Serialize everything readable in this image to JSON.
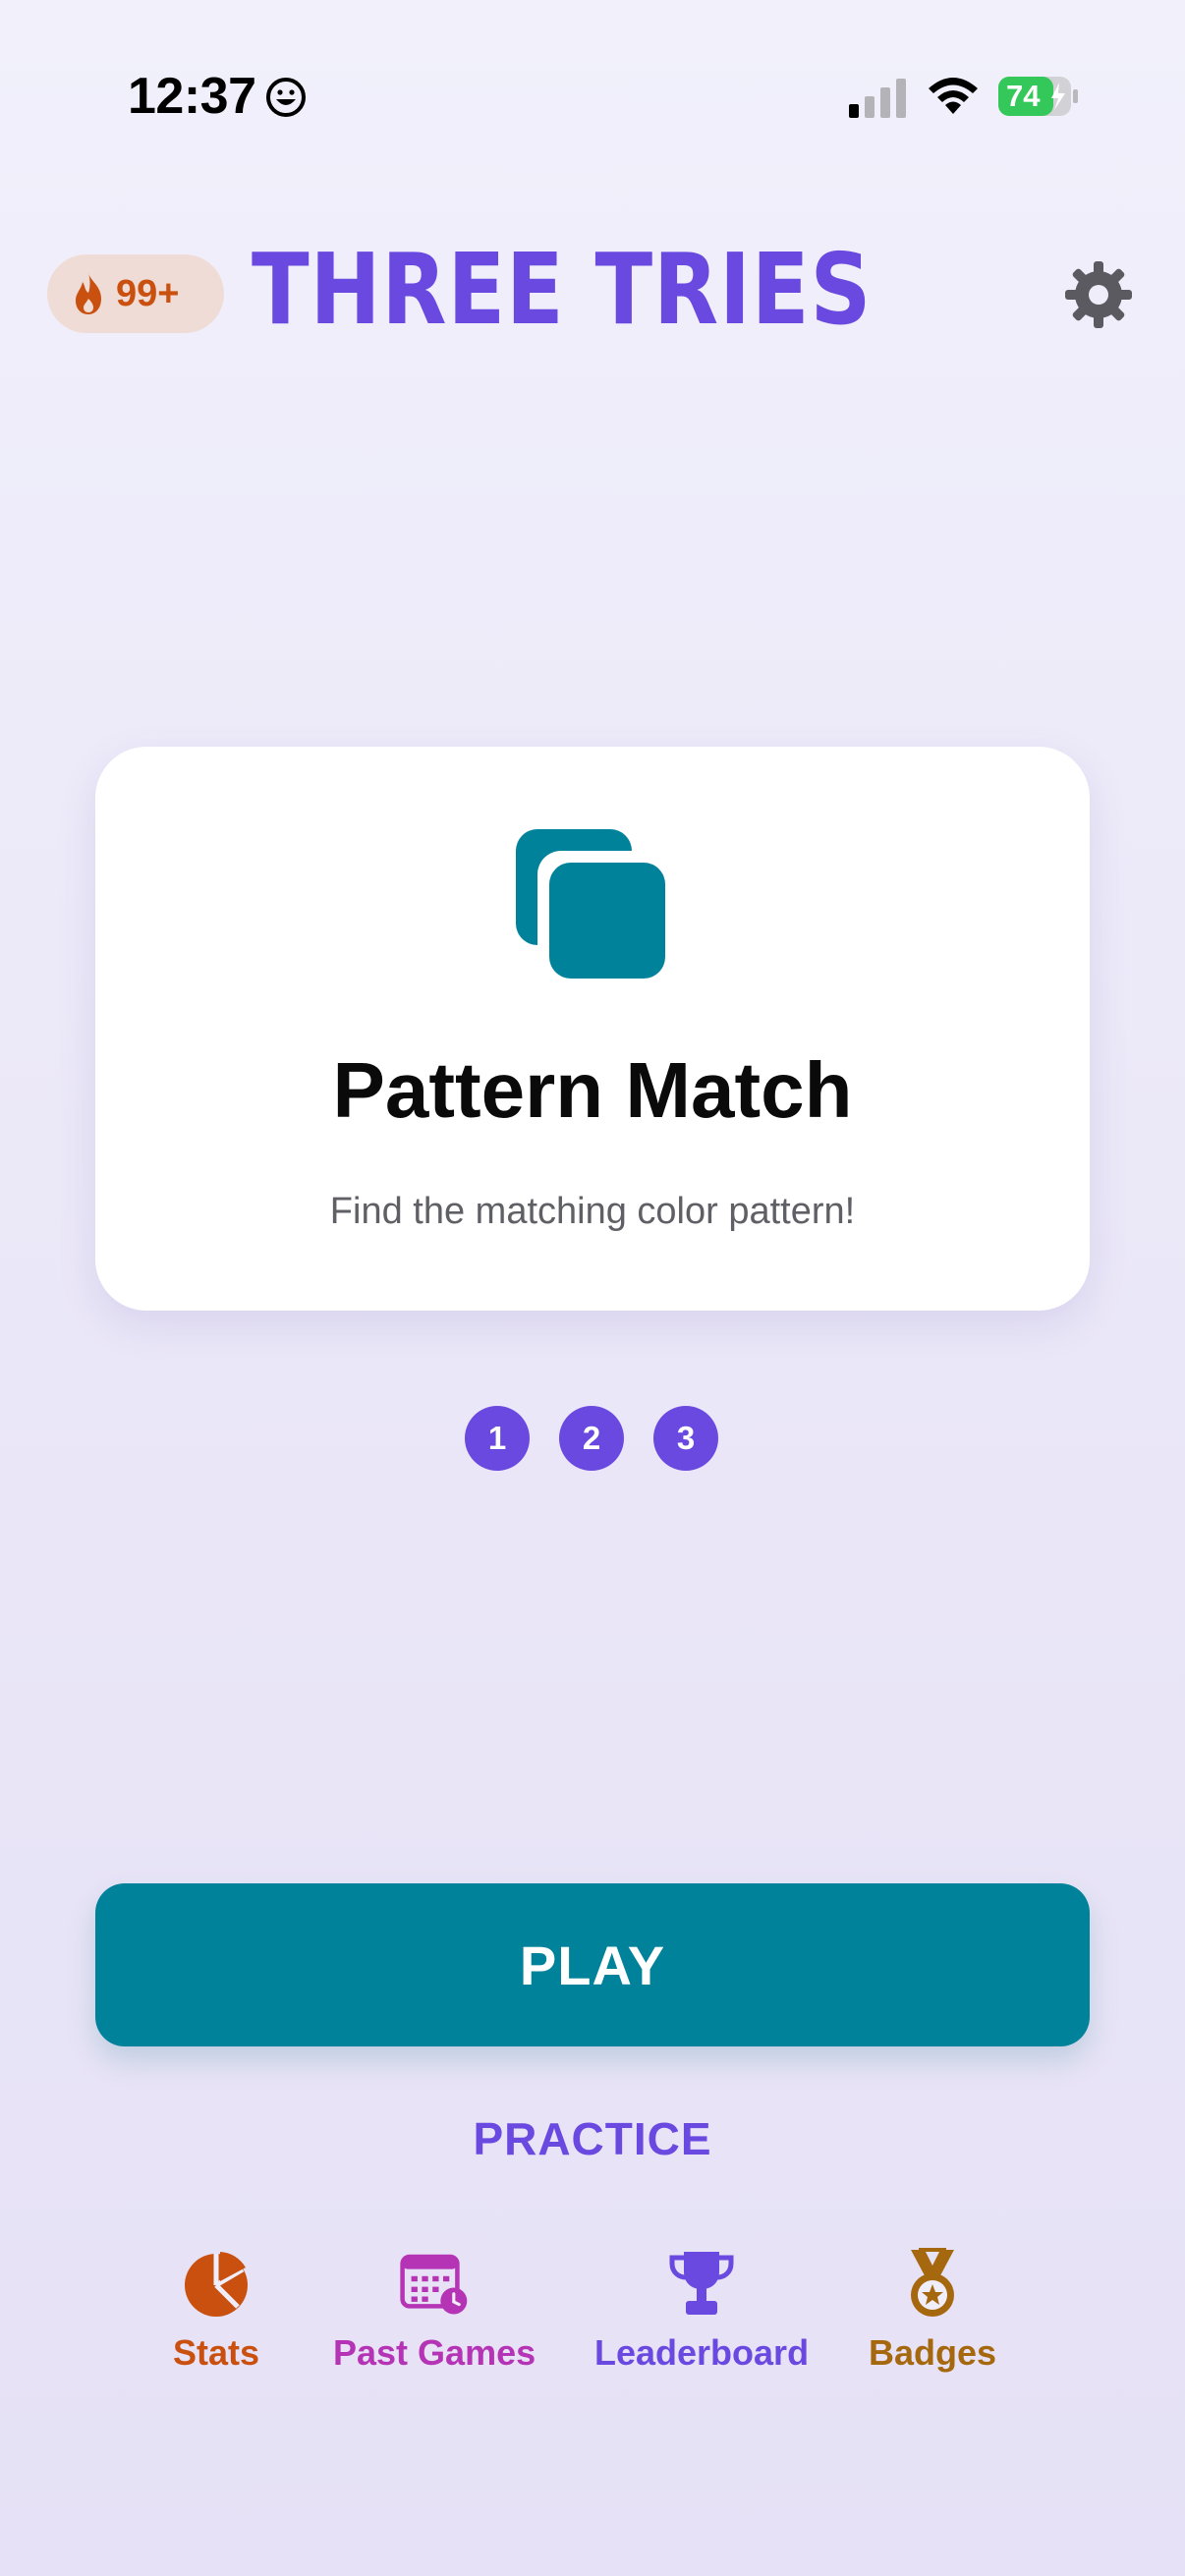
{
  "status_bar": {
    "time": "12:37",
    "battery_level": "74",
    "icons": [
      "smiley-face-icon",
      "cellular-signal-icon",
      "wifi-icon",
      "battery-charging-icon"
    ]
  },
  "header": {
    "streak_count": "99+",
    "streak_icon": "flame-icon",
    "title": "THREE TRIES",
    "settings_icon": "gear-icon"
  },
  "game_card": {
    "icon": "stacked-squares-icon",
    "title": "Pattern Match",
    "subtitle": "Find the matching color pattern!"
  },
  "tries": [
    "1",
    "2",
    "3"
  ],
  "actions": {
    "play_label": "PLAY",
    "practice_label": "PRACTICE"
  },
  "nav": [
    {
      "label": "Stats",
      "icon": "pie-chart-icon",
      "color": "#c9500f"
    },
    {
      "label": "Past Games",
      "icon": "calendar-clock-icon",
      "color": "#b534b5"
    },
    {
      "label": "Leaderboard",
      "icon": "trophy-icon",
      "color": "#6a49e0"
    },
    {
      "label": "Badges",
      "icon": "medal-icon",
      "color": "#a6680e"
    }
  ],
  "colors": {
    "accent_purple": "#6a49e0",
    "play_teal": "#00839a",
    "streak_orange": "#c9500f",
    "battery_green": "#34c759"
  }
}
